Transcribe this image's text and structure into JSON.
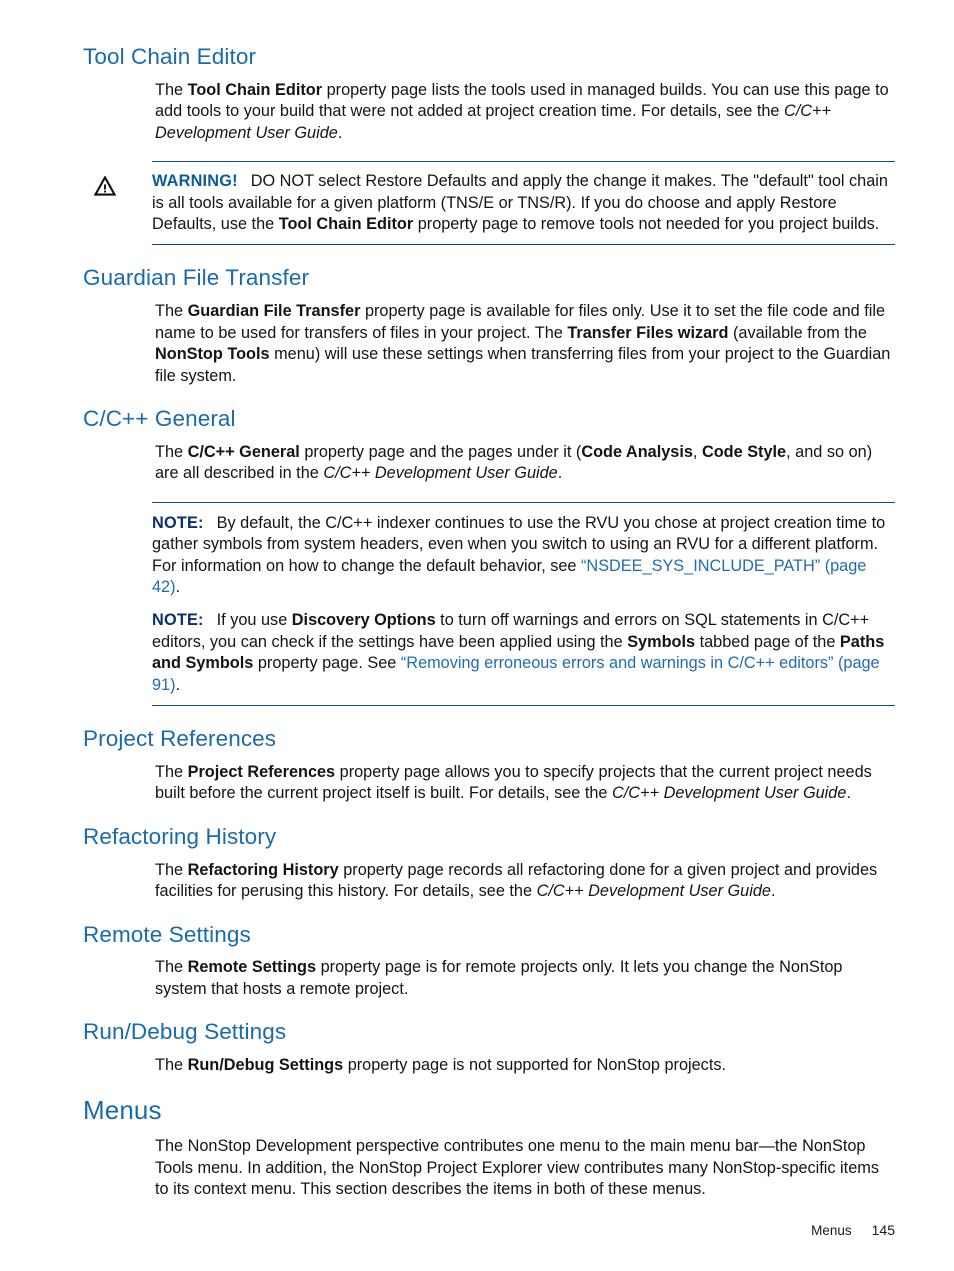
{
  "page": {
    "footer_label": "Menus",
    "footer_page_number": "145"
  },
  "colors": {
    "heading_blue": "#1a6bab",
    "link_blue": "#1f6cb0",
    "rule_navy": "#0d4d80",
    "warning_label_blue": "#0d5c96",
    "note_label_blue": "#0d2f6e"
  },
  "sections": {
    "tool_chain_editor": {
      "heading": "Tool Chain Editor",
      "para": {
        "t1": "The ",
        "b1": "Tool Chain Editor",
        "t2": " property page lists the tools used in managed builds. You can use this page to add tools to your build that were not added at project creation time. For details, see the ",
        "i1": "C/C++ Development User Guide",
        "t3": "."
      },
      "warning": {
        "icon": "warning-triangle-icon",
        "label": "WARNING!",
        "t1": "DO NOT select Restore Defaults and apply the change it makes. The \"default\" tool chain is all tools available for a given platform (TNS/E or TNS/R). If you do choose and apply Restore Defaults, use the ",
        "b1": "Tool Chain Editor",
        "t2": " property page to remove tools not needed for you project builds."
      }
    },
    "guardian_file_transfer": {
      "heading": "Guardian File Transfer",
      "para": {
        "t1": "The ",
        "b1": "Guardian File Transfer",
        "t2": " property page is available for files only. Use it to set the file code and file name to be used for transfers of files in your project. The ",
        "b2": "Transfer Files wizard",
        "t3": " (available from the ",
        "b3": "NonStop Tools",
        "t4": " menu) will use these settings when transferring files from your project to the Guardian file system."
      }
    },
    "c_cpp_general": {
      "heading": "C/C++ General",
      "para": {
        "t1": "The ",
        "b1": "C/C++ General",
        "t2": " property page and the pages under it (",
        "b2": "Code Analysis",
        "t3": ", ",
        "b3": "Code Style",
        "t4": ", and so on) are all described in the ",
        "i1": "C/C++ Development User Guide",
        "t5": "."
      },
      "note1": {
        "label": "NOTE:",
        "t1": "By default, the C/C++ indexer continues to use the RVU you chose at project creation time to gather symbols from system headers, even when you switch to using an RVU for a different platform. For information on how to change the default behavior, see ",
        "link": "“NSDEE_SYS_INCLUDE_PATH” (page 42)",
        "t2": "."
      },
      "note2": {
        "label": "NOTE:",
        "t1": "If you use ",
        "b1": "Discovery Options",
        "t2": " to turn off warnings and errors on SQL statements in C/C++ editors, you can check if the settings have been applied using the ",
        "b2": "Symbols",
        "t3": " tabbed page of the ",
        "b3": "Paths and Symbols",
        "t4": " property page. See ",
        "link": "“Removing erroneous errors and warnings in C/C++ editors” (page 91)",
        "t5": "."
      }
    },
    "project_references": {
      "heading": "Project References",
      "para": {
        "t1": "The ",
        "b1": "Project References",
        "t2": " property page allows you to specify projects that the current project needs built before the current project itself is built. For details, see the ",
        "i1": "C/C++ Development User Guide",
        "t3": "."
      }
    },
    "refactoring_history": {
      "heading": "Refactoring History",
      "para": {
        "t1": "The ",
        "b1": "Refactoring History",
        "t2": " property page records all refactoring done for a given project and provides facilities for perusing this history. For details, see the ",
        "i1": "C/C++ Development User Guide",
        "t3": "."
      }
    },
    "remote_settings": {
      "heading": "Remote Settings",
      "para": {
        "t1": "The ",
        "b1": "Remote Settings",
        "t2": " property page is for remote projects only. It lets you change the NonStop system that hosts a remote project."
      }
    },
    "run_debug_settings": {
      "heading": "Run/Debug Settings",
      "para": {
        "t1": "The ",
        "b1": "Run/Debug Settings",
        "t2": " property page is not supported for NonStop projects."
      }
    },
    "menus": {
      "heading": "Menus",
      "para": {
        "t1": "The NonStop Development perspective contributes one menu to the main menu bar—the NonStop Tools menu. In addition, the NonStop Project Explorer view contributes many NonStop-specific items to its context menu. This section describes the items in both of these menus."
      }
    }
  }
}
